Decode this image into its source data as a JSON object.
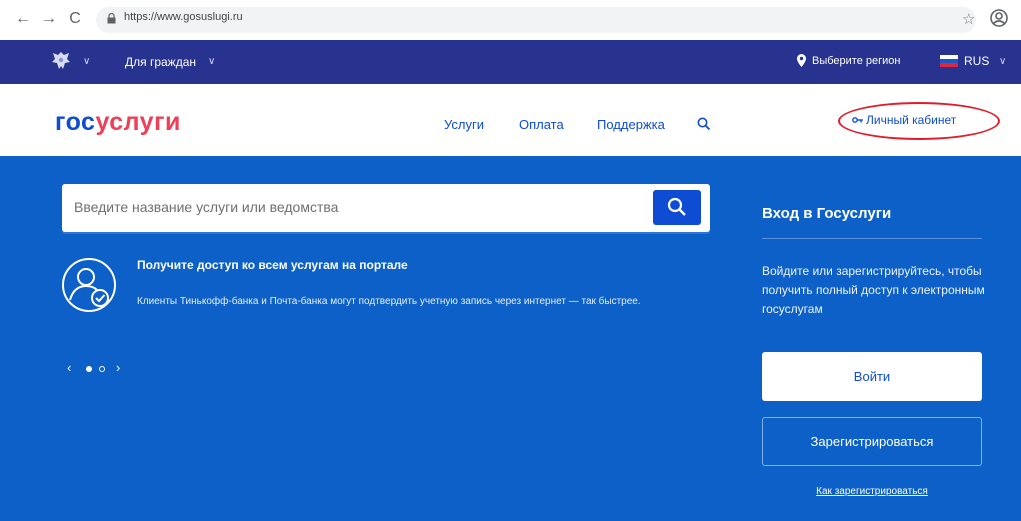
{
  "browser": {
    "back": "←",
    "forward": "→",
    "reload": "C",
    "url": "https://www.gosuslugi.ru",
    "star": "☆"
  },
  "topbar": {
    "audience": "Для граждан",
    "region": "Выберите регион",
    "language": "RUS"
  },
  "header": {
    "logo_part1": "гос",
    "logo_part2": "услуги",
    "nav": [
      "Услуги",
      "Оплата",
      "Поддержка"
    ],
    "cabinet": "Личный кабинет"
  },
  "search": {
    "placeholder": "Введите название услуги или ведомства"
  },
  "promo": {
    "title": "Получите доступ ко всем услугам на портале",
    "text": "Клиенты Тинькофф-банка и Почта-банка могут подтвердить учетную запись через интернет — так быстрее.",
    "prev": "‹",
    "next": "›"
  },
  "login": {
    "title": "Вход в Госуслуги",
    "description": "Войдите или зарегистрируйтесь, чтобы получить полный доступ к электронным госуслугам",
    "login_button": "Войти",
    "register_button": "Зарегистрироваться",
    "how_register": "Как зарегистрироваться"
  },
  "colors": {
    "strip": "#27338f",
    "body": "#0d60c7",
    "brand_blue": "#0d4cd3",
    "brand_red": "#ee3f58",
    "highlight": "#e01e2b"
  }
}
